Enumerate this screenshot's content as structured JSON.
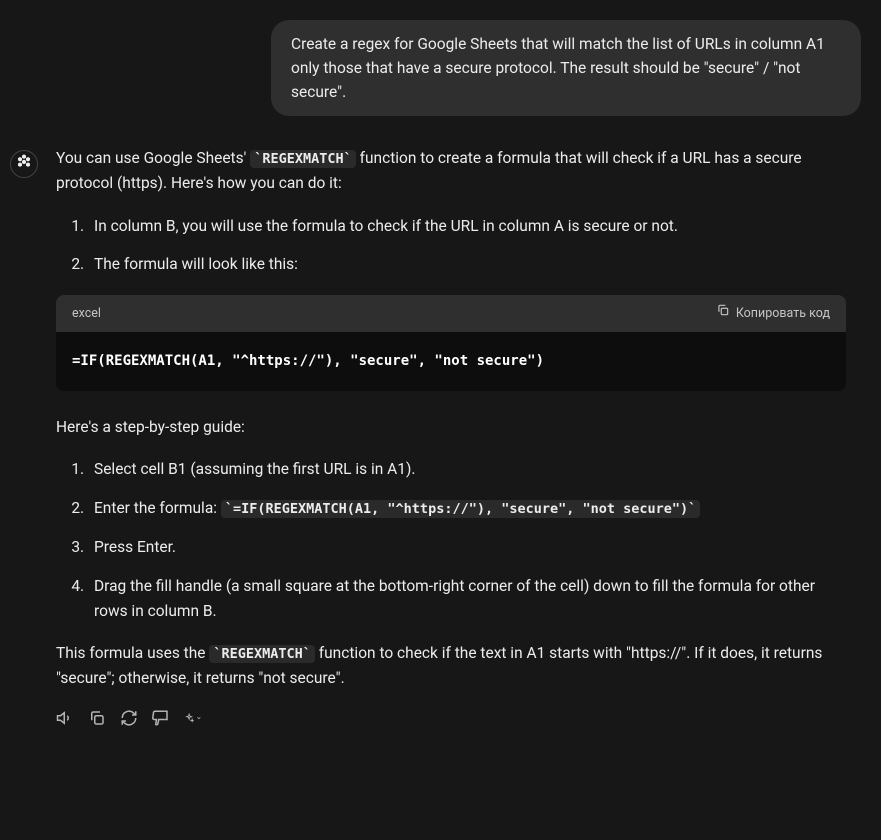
{
  "user": {
    "message": "Create a regex for Google Sheets that will match the list of URLs in column A1 only those that have a secure protocol. The result should be \"secure\" / \"not secure\"."
  },
  "assistant": {
    "intro_part1": "You can use Google Sheets' ",
    "intro_code": "REGEXMATCH",
    "intro_part2": " function to create a formula that will check if a URL has a secure protocol (https). Here's how you can do it:",
    "list1_item1": "In column B, you will use the formula to check if the URL in column A is secure or not.",
    "list1_item2": "The formula will look like this:",
    "code_lang": "excel",
    "copy_label": "Копировать код",
    "code_content": "=IF(REGEXMATCH(A1, \"^https://\"), \"secure\", \"not secure\")",
    "guide_intro": "Here's a step-by-step guide:",
    "list2_item1": "Select cell B1 (assuming the first URL is in A1).",
    "list2_item2_prefix": "Enter the formula: ",
    "list2_item2_code": "=IF(REGEXMATCH(A1, \"^https://\"), \"secure\", \"not secure\")",
    "list2_item3": "Press Enter.",
    "list2_item4": "Drag the fill handle (a small square at the bottom-right corner of the cell) down to fill the formula for other rows in column B.",
    "outro_part1": "This formula uses the ",
    "outro_code": "REGEXMATCH",
    "outro_part2": " function to check if the text in A1 starts with \"https://\". If it does, it returns \"secure\"; otherwise, it returns \"not secure\"."
  }
}
